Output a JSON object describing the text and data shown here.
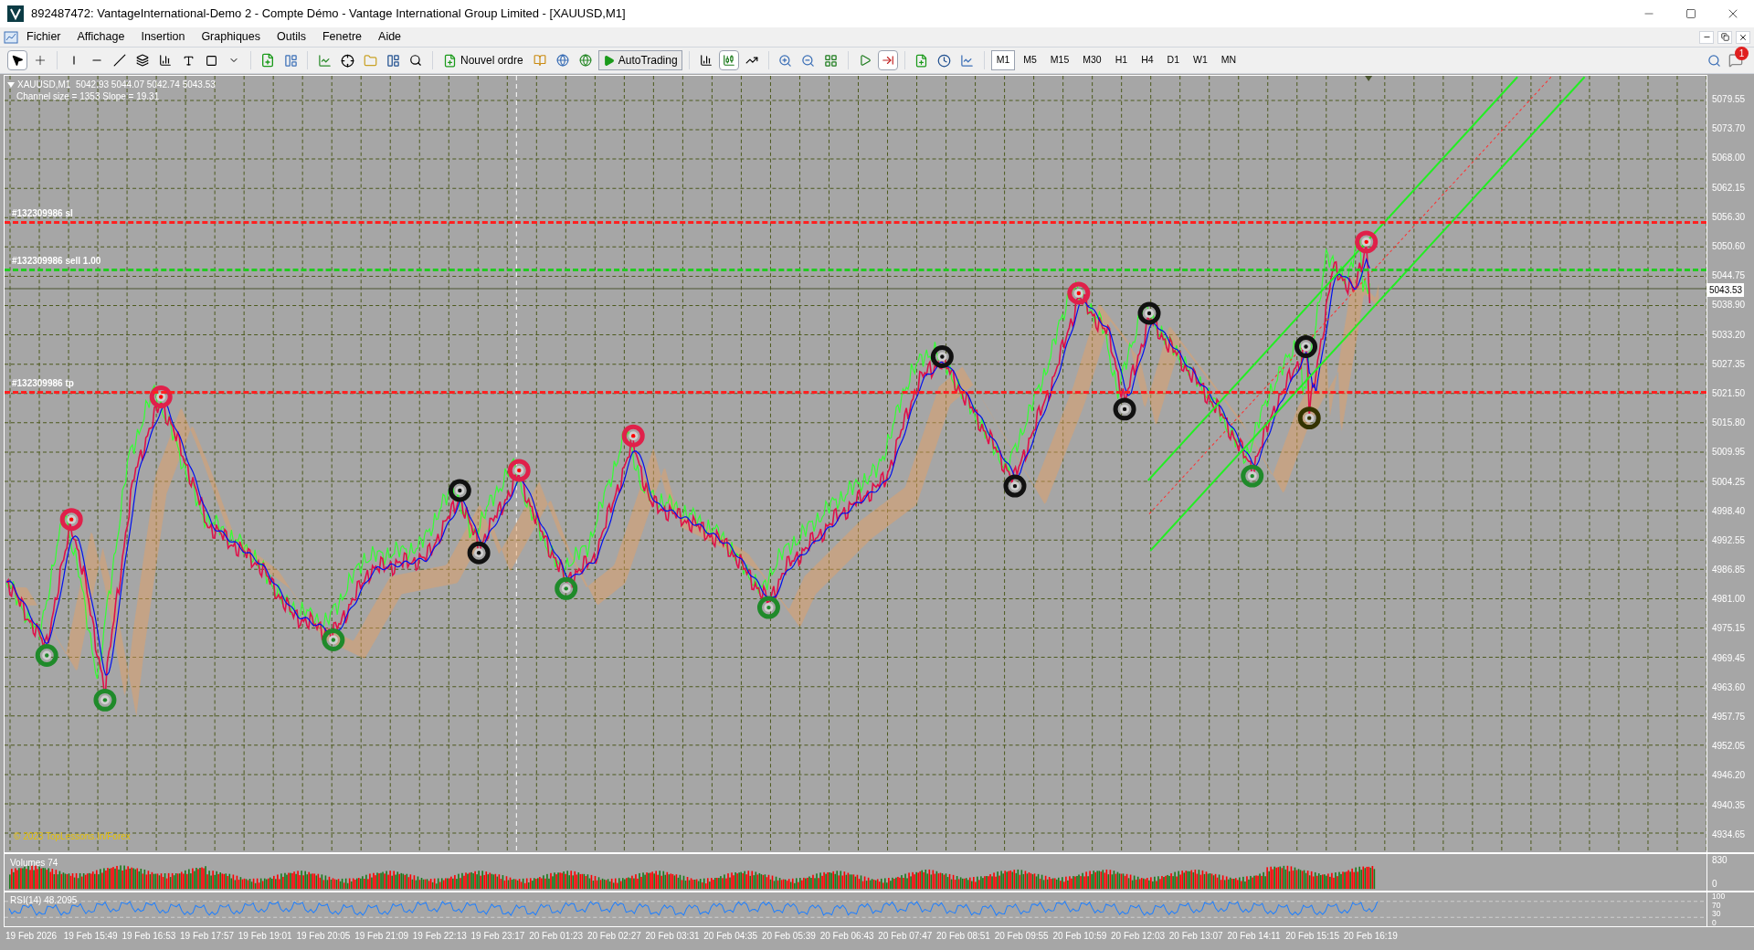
{
  "window": {
    "title": "892487472: VantageInternational-Demo 2 - Compte Démo - Vantage International Group Limited - [XAUUSD,M1]"
  },
  "menu": [
    "Fichier",
    "Affichage",
    "Insertion",
    "Graphiques",
    "Outils",
    "Fenetre",
    "Aide"
  ],
  "toolbar": {
    "new_order": "Nouvel ordre",
    "autotrading": "AutoTrading",
    "timeframes": [
      {
        "label": "M1",
        "selected": true
      },
      {
        "label": "M5",
        "selected": false
      },
      {
        "label": "M15",
        "selected": false
      },
      {
        "label": "M30",
        "selected": false
      },
      {
        "label": "H1",
        "selected": false
      },
      {
        "label": "H4",
        "selected": false
      },
      {
        "label": "D1",
        "selected": false
      },
      {
        "label": "W1",
        "selected": false
      },
      {
        "label": "MN",
        "selected": false
      }
    ]
  },
  "notifications": {
    "count": "1"
  },
  "chart": {
    "symbol_line": "XAUUSD,M1  5042.93 5044.07 5042.74 5043.53",
    "indicator_line": "Channel size = 1353 Slope = 19.31",
    "order_lines": [
      {
        "label": "#132309986 sl",
        "color": "#ff2020"
      },
      {
        "label": "#132309986 sell 1.00",
        "color": "#22cc22"
      },
      {
        "label": "#132309986 tp",
        "color": "#ff2020"
      }
    ],
    "copyright": "© 2023 TopLessons.In/Forex",
    "price_axis": [
      "5079.55",
      "5073.70",
      "5068.00",
      "5062.15",
      "5056.30",
      "5050.60",
      "5044.75",
      "5038.90",
      "5033.20",
      "5027.35",
      "5021.50",
      "5015.80",
      "5009.95",
      "5004.25",
      "4998.40",
      "4992.55",
      "4986.85",
      "4981.00",
      "4975.15",
      "4969.45",
      "4963.60",
      "4957.75",
      "4952.05",
      "4946.20",
      "4940.35",
      "4934.65"
    ],
    "current_price": "5043.53"
  },
  "volumes": {
    "label": "Volumes 74",
    "axis": [
      "830",
      "0"
    ]
  },
  "rsi": {
    "label": "RSI(14) 48.2095",
    "axis": [
      "100",
      "70",
      "30",
      "0"
    ]
  },
  "time_axis": [
    "19 Feb 2026",
    "19 Feb 15:49",
    "19 Feb 16:53",
    "19 Feb 17:57",
    "19 Feb 19:01",
    "19 Feb 20:05",
    "19 Feb 21:09",
    "19 Feb 22:13",
    "19 Feb 23:17",
    "20 Feb 01:23",
    "20 Feb 02:27",
    "20 Feb 03:31",
    "20 Feb 04:35",
    "20 Feb 05:39",
    "20 Feb 06:43",
    "20 Feb 07:47",
    "20 Feb 08:51",
    "20 Feb 09:55",
    "20 Feb 10:59",
    "20 Feb 12:03",
    "20 Feb 13:07",
    "20 Feb 14:11",
    "20 Feb 15:15",
    "20 Feb 16:19"
  ]
}
